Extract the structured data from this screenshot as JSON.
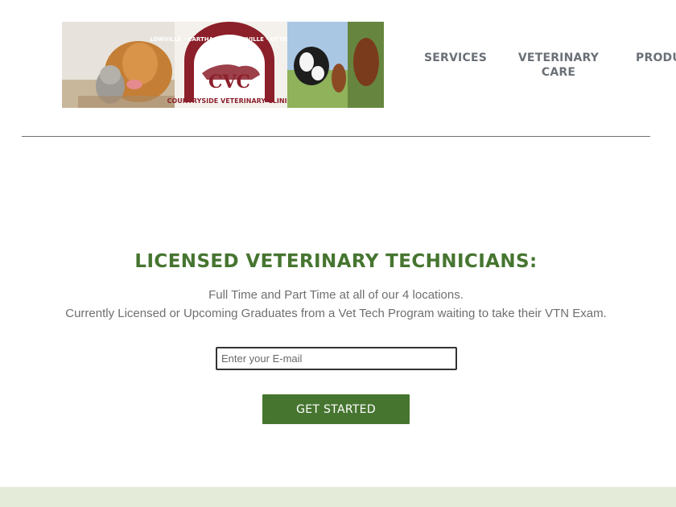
{
  "logo": {
    "arch_text": "LOWVILLE · CARTHAGE · BOONVILLE · OTTER LAKE",
    "initials": "CVC",
    "name": "COUNTRYSIDE VETERINARY CLINIC"
  },
  "nav": {
    "items": [
      {
        "label": "SERVICES"
      },
      {
        "label_line1": "VETERINARY",
        "label_line2": "CARE"
      },
      {
        "label": "PRODU"
      }
    ]
  },
  "main": {
    "headline": "LICENSED VETERINARY TECHNICIANS:",
    "line1": "Full Time and Part Time at all of our 4 locations.",
    "line2": "Currently Licensed or Upcoming Graduates from a Vet Tech Program waiting to take their VTN Exam.",
    "email_placeholder": "Enter your E-mail",
    "cta_label": "GET STARTED"
  },
  "colors": {
    "accent_green": "#467530",
    "nav_text": "#6b7077",
    "body_text": "#6f6f6f",
    "footer_band": "#e4ecd9",
    "logo_maroon": "#8b1f2a"
  }
}
